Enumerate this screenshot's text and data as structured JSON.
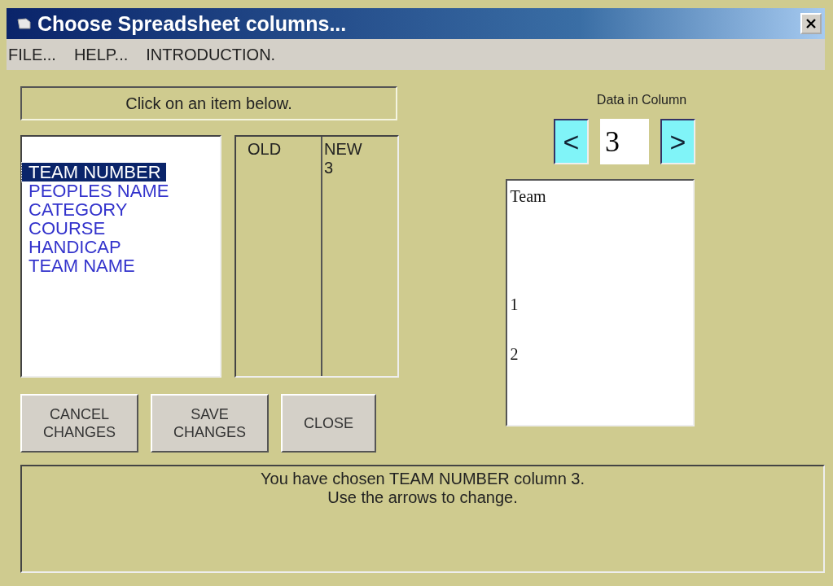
{
  "window": {
    "title": "Choose Spreadsheet columns..."
  },
  "menu": [
    "FILE...",
    "HELP...",
    "INTRODUCTION."
  ],
  "prompt": "Click on an item below.",
  "items": [
    {
      "label": "TEAM NUMBER",
      "selected": true
    },
    {
      "label": "PEOPLES NAME",
      "selected": false
    },
    {
      "label": "CATEGORY",
      "selected": false
    },
    {
      "label": "COURSE",
      "selected": false
    },
    {
      "label": "HANDICAP",
      "selected": false
    },
    {
      "label": "TEAM NAME",
      "selected": false
    }
  ],
  "mapping": {
    "columns": [
      {
        "heading": "OLD"
      },
      {
        "heading": "NEW",
        "values": [
          "3"
        ]
      }
    ]
  },
  "buttons": [
    {
      "label": "CANCEL\nCHANGES"
    },
    {
      "label": "SAVE\nCHANGES"
    },
    {
      "label": "CLOSE"
    }
  ],
  "column_picker": {
    "label": "Data in Column",
    "prev": "<",
    "value": "3",
    "next": ">"
  },
  "column_data": [
    "Team",
    "1",
    "2"
  ],
  "status": [
    "You have chosen TEAM NUMBER column 3.",
    "Use the arrows to change."
  ]
}
